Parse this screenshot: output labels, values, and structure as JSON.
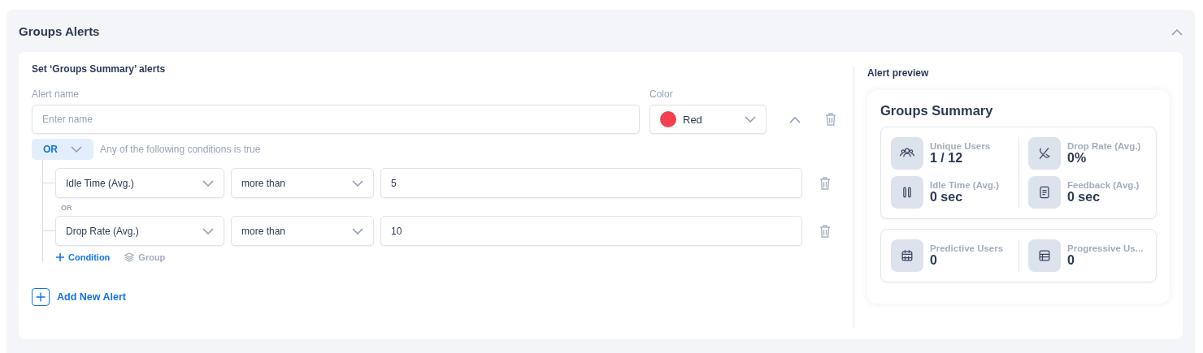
{
  "section": {
    "title": "Groups Alerts",
    "expanded": true
  },
  "editor": {
    "title": "Set ‘Groups Summary’ alerts",
    "alerts": [
      {
        "name_label": "Alert name",
        "name_placeholder": "Enter name",
        "color_label": "Color",
        "color_value": "Red",
        "color": "#f43f4e",
        "expanded": true,
        "operator": "OR",
        "operator_hint": "Any of the following conditions is true",
        "conditions": [
          {
            "field": "Idle Time (Avg.)",
            "comparison": "more than",
            "value": "5"
          },
          {
            "field": "Drop Rate (Avg.)",
            "comparison": "more than",
            "value": "10"
          }
        ],
        "joiner": "OR",
        "add_condition": "Condition",
        "add_group": "Group"
      }
    ],
    "add_alert": "Add New Alert"
  },
  "preview": {
    "title": "Alert preview",
    "card_title": "Groups Summary",
    "groups": [
      [
        {
          "label": "Unique Users",
          "value": "1 / 12"
        },
        {
          "label": "Drop Rate (Avg.)",
          "value": "0%"
        },
        {
          "label": "Idle Time (Avg.)",
          "value": "0 sec"
        },
        {
          "label": "Feedback (Avg.)",
          "value": "0 sec"
        }
      ],
      [
        {
          "label": "Predictive Users",
          "value": "0"
        },
        {
          "label": "Progressive Us...",
          "value": "0"
        }
      ]
    ]
  }
}
